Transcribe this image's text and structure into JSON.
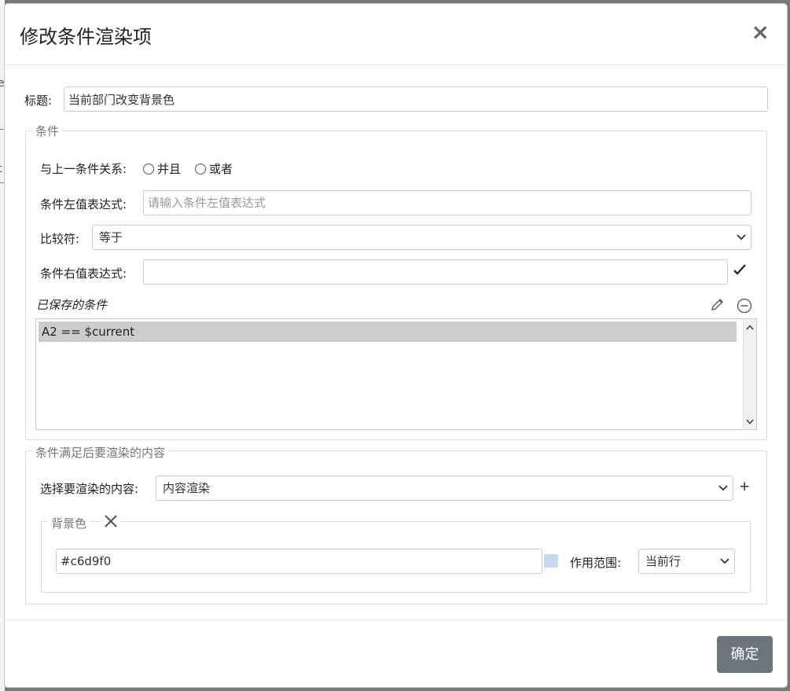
{
  "modal": {
    "title": "修改条件渲染项",
    "close_label": "×"
  },
  "title_field": {
    "label": "标题:",
    "value": "当前部门改变背景色"
  },
  "conditions": {
    "legend": "条件",
    "relation_label": "与上一条件关系:",
    "relation_options": [
      "并且",
      "或者"
    ],
    "left_expr_label": "条件左值表达式:",
    "left_expr_placeholder": "请输入条件左值表达式",
    "left_expr_value": "",
    "operator_label": "比较符:",
    "operator_value": "等于",
    "right_expr_label": "条件右值表达式:",
    "right_expr_value": "",
    "saved_label": "已保存的条件",
    "saved_items": [
      "A2 == $current"
    ]
  },
  "render": {
    "legend": "条件满足后要渲染的内容",
    "select_label": "选择要渲染的内容:",
    "select_value": "内容渲染",
    "add_label": "+",
    "bg": {
      "legend": "背景色",
      "color_value": "#c6d9f0",
      "scope_label": "作用范围:",
      "scope_value": "当前行"
    }
  },
  "footer": {
    "confirm_label": "确定"
  },
  "colors": {
    "swatch": "#c6d9f0",
    "confirm_bg": "#6c757d",
    "selected_row": "#cdcdcd"
  }
}
